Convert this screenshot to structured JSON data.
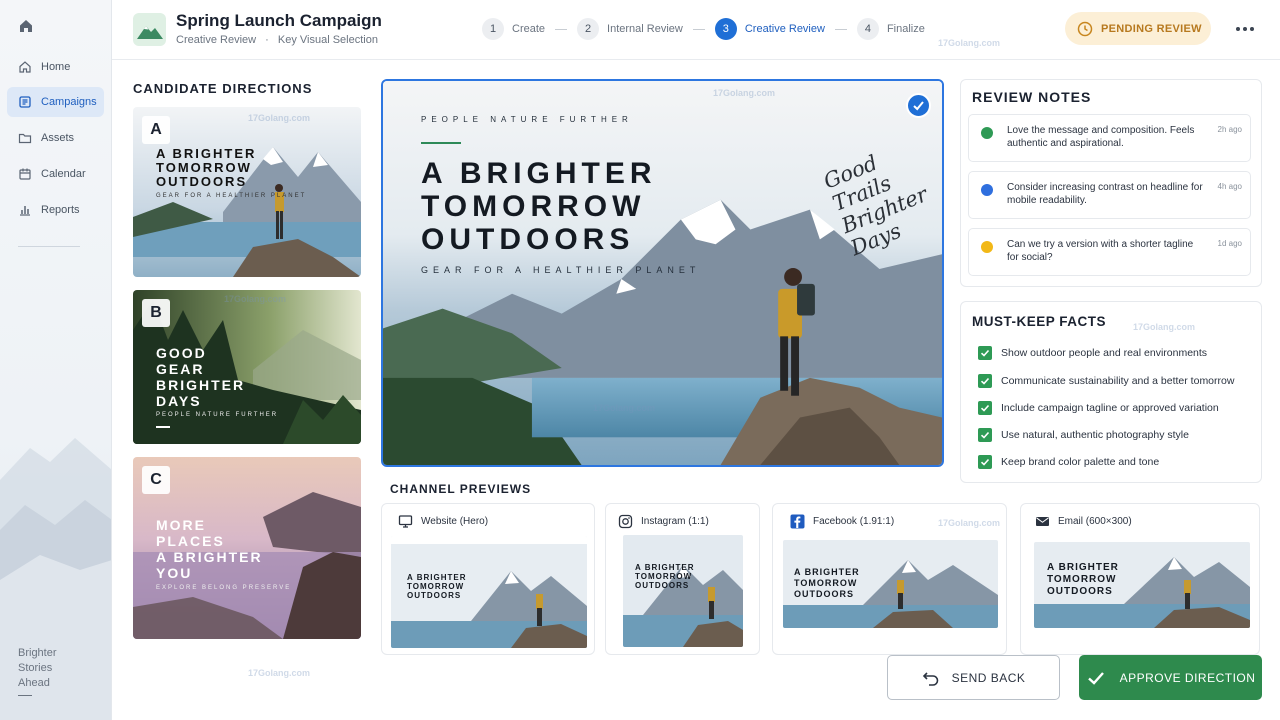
{
  "app": {
    "name": "Brighter Stories Ahead",
    "name_lines": [
      "Brighter",
      "Stories",
      "Ahead"
    ]
  },
  "sidebar": {
    "items": [
      {
        "label": "Home",
        "icon": "home-icon",
        "active": false
      },
      {
        "label": "Campaigns",
        "icon": "campaigns-icon",
        "active": true
      },
      {
        "label": "Assets",
        "icon": "folder-icon",
        "active": false
      },
      {
        "label": "Calendar",
        "icon": "calendar-icon",
        "active": false
      },
      {
        "label": "Reports",
        "icon": "reports-icon",
        "active": false
      }
    ]
  },
  "header": {
    "title": "Spring Launch Campaign",
    "breadcrumb": [
      "Creative Review",
      "Key Visual Selection"
    ],
    "status": "PENDING REVIEW",
    "steps": [
      {
        "num": "1",
        "label": "Create"
      },
      {
        "num": "2",
        "label": "Internal Review"
      },
      {
        "num": "3",
        "label": "Creative Review",
        "active": true
      },
      {
        "num": "4",
        "label": "Finalize"
      }
    ]
  },
  "candidates": {
    "title": "CANDIDATE DIRECTIONS",
    "items": [
      {
        "letter": "A",
        "title": "A BRIGHTER\nTOMORROW\nOUTDOORS",
        "tagline": "GEAR FOR A HEALTHIER PLANET"
      },
      {
        "letter": "B",
        "title": "GOOD\nGEAR\nBRIGHTER\nDAYS",
        "tagline": "PEOPLE  NATURE  FURTHER"
      },
      {
        "letter": "C",
        "title": "MORE\nPLACES\nA BRIGHTER\nYOU",
        "tagline": "EXPLORE  BELONG  PRESERVE"
      }
    ]
  },
  "hero": {
    "tagline_top": "PEOPLE   NATURE   FURTHER",
    "title": "A BRIGHTER\nTOMORROW\nOUTDOORS",
    "subtitle": "GEAR FOR A HEALTHIER PLANET",
    "script": "Good\nTrails\nBrighter\nDays"
  },
  "previews": {
    "title": "CHANNEL PREVIEWS",
    "items": [
      {
        "label": "Website (Hero)",
        "icon": "monitor-icon",
        "headline": "A BRIGHTER\nTOMORROW\nOUTDOORS"
      },
      {
        "label": "Instagram (1:1)",
        "icon": "instagram-icon",
        "headline": "A BRIGHTER\nTOMORROW\nOUTDOORS"
      },
      {
        "label": "Facebook (1.91:1)",
        "icon": "facebook-icon",
        "headline": "A BRIGHTER\nTOMORROW\nOUTDOORS"
      },
      {
        "label": "Email  (600×300)",
        "icon": "mail-icon",
        "headline": "A BRIGHTER\nTOMORROW\nOUTDOORS"
      }
    ]
  },
  "review_notes": {
    "title": "REVIEW NOTES",
    "items": [
      {
        "text": "Love the message and composition. Feels authentic and aspirational.",
        "ago": "2h ago",
        "color": "#2e9a55"
      },
      {
        "text": "Consider increasing contrast on headline for mobile readability.",
        "ago": "4h ago",
        "color": "#2f6fde"
      },
      {
        "text": "Can we try a version with a shorter tagline for social?",
        "ago": "1d ago",
        "color": "#f2b817"
      }
    ]
  },
  "facts": {
    "title": "MUST-KEEP FACTS",
    "items": [
      "Show outdoor people and real environments",
      "Communicate sustainability and a better tomorrow",
      "Include campaign tagline or approved variation",
      "Use natural, authentic photography style",
      "Keep brand color palette and tone"
    ]
  },
  "actions": {
    "send_back": "SEND BACK",
    "approve": "APPROVE DIRECTION"
  },
  "watermark": "17Golang.com",
  "colors": {
    "accent": "#1f6fd6",
    "approve": "#2e8a4d",
    "pending_bg": "#fcefd6",
    "pending_text": "#b7791f"
  }
}
